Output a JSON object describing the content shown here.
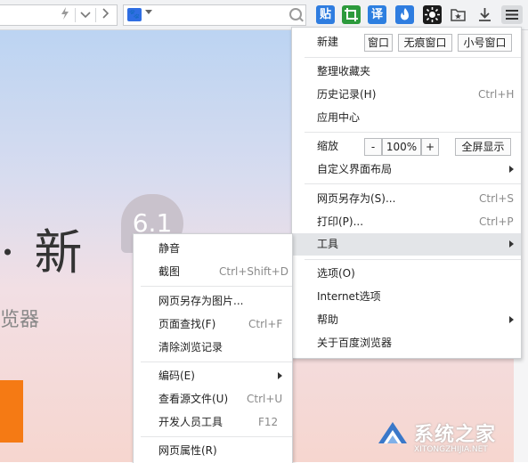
{
  "toolbar": {
    "addr_icons": [
      "lightning-icon",
      "chevron-down-icon",
      "chevron-right-icon"
    ],
    "search_engine_icon": "paw-icon",
    "buttons": [
      {
        "name": "baidu-tieba-icon",
        "text": "贴",
        "color": "#2f7de0"
      },
      {
        "name": "crop-icon",
        "text": "",
        "color": "#2c9a3c"
      },
      {
        "name": "translate-icon",
        "text": "译",
        "color": "#2d7fe0"
      },
      {
        "name": "fire-icon",
        "text": "",
        "color": "#2f7de0"
      },
      {
        "name": "brightness-icon",
        "text": "",
        "color": "#1b1b1b"
      },
      {
        "name": "star-folder-icon",
        "text": "",
        "color": "#444444"
      },
      {
        "name": "download-icon",
        "text": "",
        "color": "#444444"
      },
      {
        "name": "menu-icon",
        "text": "",
        "color": "#333333"
      }
    ]
  },
  "page": {
    "hero": "· 新",
    "badge": "6.1",
    "subtitle": "览器",
    "accent": "#f57a14"
  },
  "watermark": {
    "title": "系统之家",
    "sub": "XITONGZHIJIA.NET"
  },
  "main_menu": {
    "new_label": "新建",
    "new_buttons": [
      "窗口",
      "无痕窗口",
      "小号窗口"
    ],
    "bookmarks": "整理收藏夹",
    "history": "历史记录(H)",
    "history_shortcut": "Ctrl+H",
    "app_center": "应用中心",
    "zoom_label": "缩放",
    "zoom_minus": "-",
    "zoom_value": "100%",
    "zoom_plus": "+",
    "fullscreen": "全屏显示",
    "customize": "自定义界面布局",
    "save_as": "网页另存为(S)...",
    "save_as_shortcut": "Ctrl+S",
    "print": "打印(P)...",
    "print_shortcut": "Ctrl+P",
    "tools": "工具",
    "options": "选项(O)",
    "internet_options": "Internet选项",
    "help": "帮助",
    "about": "关于百度浏览器"
  },
  "tools_menu": {
    "mute": "静音",
    "screenshot": "截图",
    "screenshot_shortcut": "Ctrl+Shift+D",
    "save_as_image": "网页另存为图片...",
    "find": "页面查找(F)",
    "find_shortcut": "Ctrl+F",
    "clear_history": "清除浏览记录",
    "encoding": "编码(E)",
    "view_source": "查看源文件(U)",
    "view_source_shortcut": "Ctrl+U",
    "devtools": "开发人员工具",
    "devtools_shortcut": "F12",
    "properties": "网页属性(R)"
  }
}
